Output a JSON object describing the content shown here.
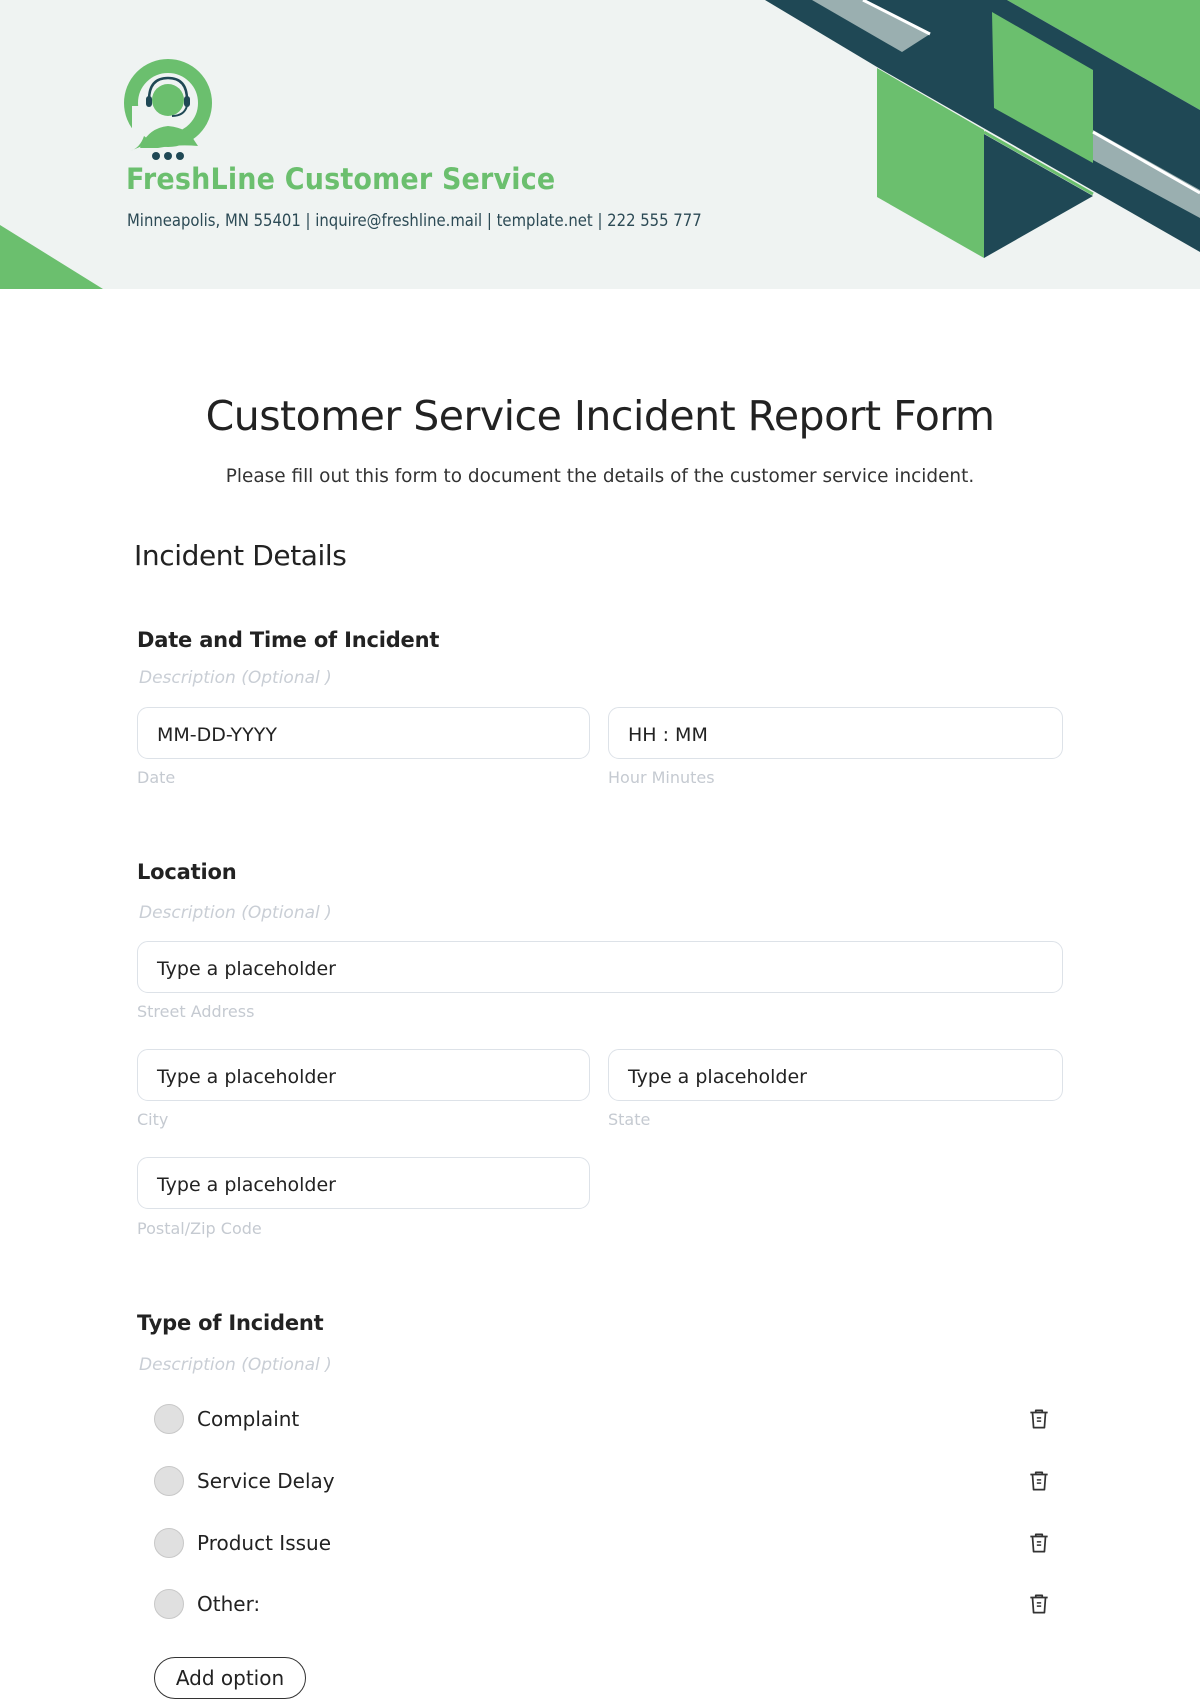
{
  "header": {
    "company_name": "FreshLine Customer Service",
    "contact_line": "Minneapolis, MN 55401 | inquire@freshline.mail | template.net | 222 555 777",
    "logo_icon": "headset-agent-chat-icon",
    "colors": {
      "brand_green": "#6bbf6e",
      "dark_teal": "#1f4855",
      "stripe_gray": "#9aafb0",
      "header_bg": "#eff3f2"
    }
  },
  "form": {
    "title": "Customer Service Incident Report Form",
    "subtitle": "Please fill out this form to document the details of the customer service incident.",
    "section_title": "Incident Details",
    "questions": {
      "datetime": {
        "label": "Date and Time of Incident",
        "description": "Description  (Optional )",
        "fields": [
          {
            "placeholder": "MM-DD-YYYY",
            "sub_label": "Date"
          },
          {
            "placeholder": "HH : MM",
            "sub_label": "Hour Minutes"
          }
        ]
      },
      "location": {
        "label": "Location",
        "description": "Description  (Optional )",
        "fields": [
          {
            "placeholder": "Type a placeholder",
            "sub_label": "Street Address"
          },
          {
            "placeholder": "Type a placeholder",
            "sub_label": "City"
          },
          {
            "placeholder": "Type a placeholder",
            "sub_label": "State"
          },
          {
            "placeholder": "Type a placeholder",
            "sub_label": "Postal/Zip Code"
          }
        ]
      },
      "incident_type": {
        "label": "Type of Incident",
        "description": "Description  (Optional )",
        "options": [
          {
            "label": "Complaint",
            "selected": false
          },
          {
            "label": "Service Delay",
            "selected": false
          },
          {
            "label": "Product Issue",
            "selected": false
          },
          {
            "label": "Other:",
            "selected": false
          }
        ],
        "delete_icon": "trash-icon",
        "add_option_label": "Add option"
      }
    }
  }
}
